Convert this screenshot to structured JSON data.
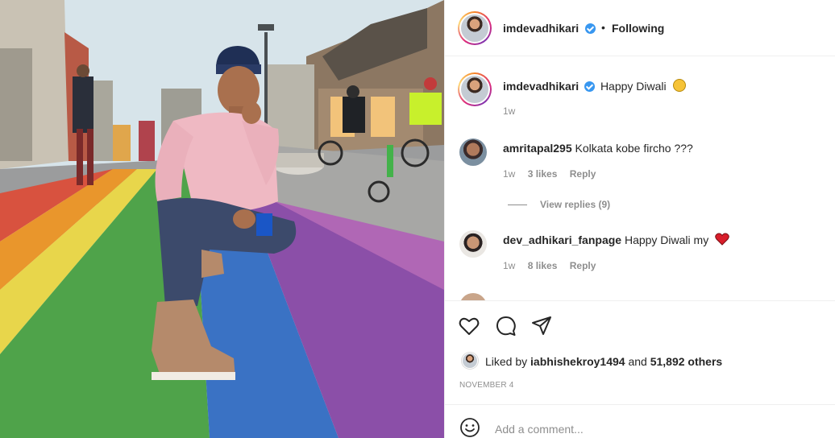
{
  "post": {
    "author": "imdevadhikari",
    "follow_separator": "•",
    "follow_status": "Following",
    "caption": "Happy Diwali",
    "caption_time": "1w",
    "likes_prefix": "Liked by",
    "liked_by_user": "iabhishekroy1494",
    "likes_and": "and",
    "likes_others": "51,892 others",
    "date": "NOVEMBER 4",
    "add_comment_placeholder": "Add a comment..."
  },
  "comments": [
    {
      "user": "amritapal295",
      "text": "Kolkata kobe fircho ???",
      "time": "1w",
      "likes": "3 likes",
      "reply": "Reply",
      "view_replies": "View replies (9)"
    },
    {
      "user": "dev_adhikari_fanpage",
      "text": "Happy Diwali my",
      "time": "1w",
      "likes": "8 likes",
      "reply": "Reply"
    }
  ],
  "colors": {
    "verified": "#3897f0",
    "text": "#262626",
    "muted": "#8e8e8e",
    "heart": "#ed4956"
  },
  "icons": [
    "verified-badge-icon",
    "smile-emoji-icon",
    "heart-icon",
    "comment-icon",
    "share-icon",
    "emoji-picker-icon"
  ]
}
